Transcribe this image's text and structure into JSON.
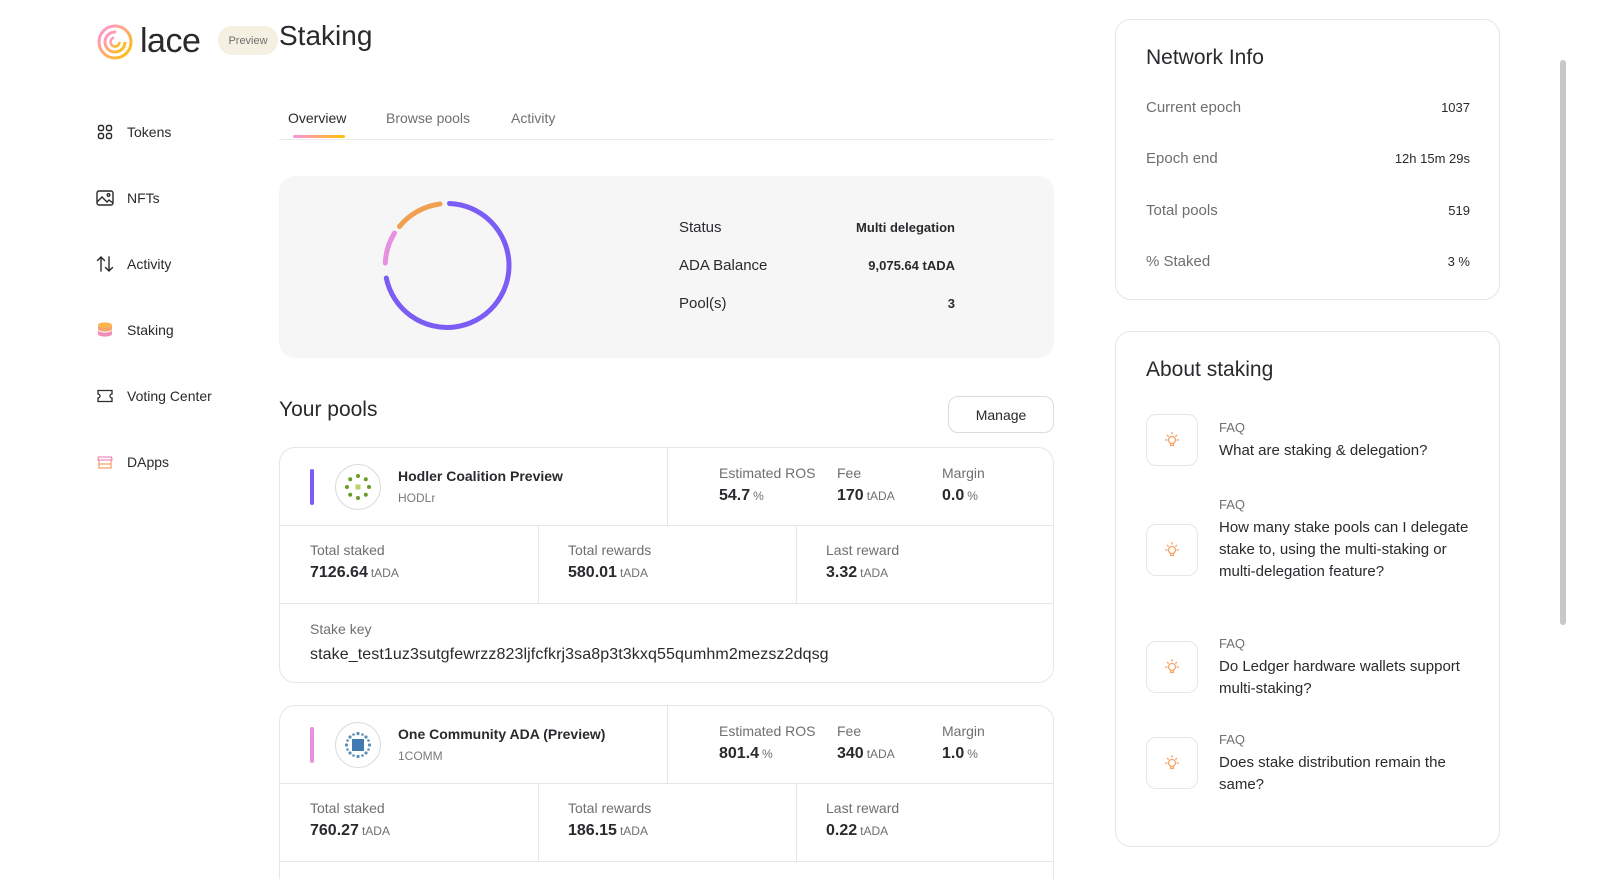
{
  "app": {
    "logo_text": "lace",
    "badge": "Preview",
    "page_title": "Staking"
  },
  "sidebar": {
    "items": [
      {
        "label": "Tokens",
        "icon": "grid-icon"
      },
      {
        "label": "NFTs",
        "icon": "image-icon"
      },
      {
        "label": "Activity",
        "icon": "arrows-updown-icon"
      },
      {
        "label": "Staking",
        "icon": "coins-stack-icon"
      },
      {
        "label": "Voting Center",
        "icon": "ticket-icon"
      },
      {
        "label": "DApps",
        "icon": "store-icon"
      }
    ]
  },
  "tabs": [
    {
      "label": "Overview",
      "active": true
    },
    {
      "label": "Browse pools"
    },
    {
      "label": "Activity"
    }
  ],
  "summary": {
    "status_label": "Status",
    "status_value": "Multi delegation",
    "balance_label": "ADA Balance",
    "balance_value": "9,075.64 tADA",
    "pools_label": "Pool(s)",
    "pools_value": "3"
  },
  "donut": {
    "segments_colors": [
      "#7b5cf5",
      "#e890e0",
      "#f0a050"
    ]
  },
  "your_pools": {
    "title": "Your pools",
    "manage_label": "Manage"
  },
  "labels": {
    "ros": "Estimated ROS",
    "fee": "Fee",
    "margin": "Margin",
    "total_staked": "Total staked",
    "total_rewards": "Total rewards",
    "last_reward": "Last reward",
    "stake_key": "Stake key",
    "unit": "tADA",
    "pct": "%"
  },
  "pools": [
    {
      "name": "Hodler Coalition Preview",
      "ticker": "HODLr",
      "color": "#7b5cf5",
      "ros": "54.7",
      "fee": "170",
      "margin": "0.0",
      "total_staked": "7126.64",
      "total_rewards": "580.01",
      "last_reward": "3.32",
      "stake_key": "stake_test1uz3sutgfewrzz823ljfcfkrj3sa8p3t3kxq55qumhm2mezsz2dqsg"
    },
    {
      "name": "One Community ADA (Preview)",
      "ticker": "1COMM",
      "color": "#e890e0",
      "ros": "801.4",
      "fee": "340",
      "margin": "1.0",
      "total_staked": "760.27",
      "total_rewards": "186.15",
      "last_reward": "0.22"
    }
  ],
  "network_info": {
    "title": "Network Info",
    "rows": [
      {
        "label": "Current epoch",
        "value": "1037"
      },
      {
        "label": "Epoch end",
        "value": "12h 15m 29s"
      },
      {
        "label": "Total pools",
        "value": "519"
      },
      {
        "label": "% Staked",
        "value": "3 %"
      }
    ]
  },
  "about": {
    "title": "About staking",
    "faq_tag": "FAQ",
    "items": [
      {
        "q": "What are staking & delegation?"
      },
      {
        "q": "How many stake pools can I delegate stake to, using the multi-staking or multi-delegation feature?"
      },
      {
        "q": "Do Ledger hardware wallets support multi-staking?"
      },
      {
        "q": "Does stake distribution remain the same?"
      }
    ]
  }
}
